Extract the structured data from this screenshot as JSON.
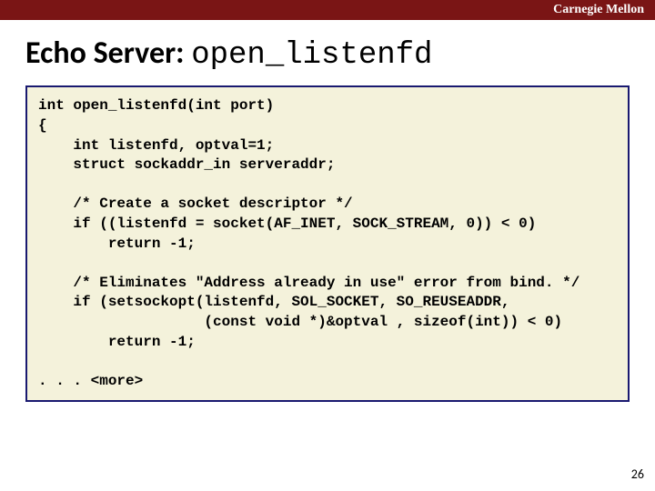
{
  "header": {
    "brand": "Carnegie Mellon"
  },
  "title": {
    "prefix": "Echo Server: ",
    "func": "open_listenfd"
  },
  "code": {
    "l01": "int open_listenfd(int port)",
    "l02": "{",
    "l03": "    int listenfd, optval=1;",
    "l04": "    struct sockaddr_in serveraddr;",
    "l05": "",
    "l06": "    /* Create a socket descriptor */",
    "l07": "    if ((listenfd = socket(AF_INET, SOCK_STREAM, 0)) < 0)",
    "l08": "        return -1;",
    "l09": "",
    "l10": "    /* Eliminates \"Address already in use\" error from bind. */",
    "l11": "    if (setsockopt(listenfd, SOL_SOCKET, SO_REUSEADDR,",
    "l12": "                   (const void *)&optval , sizeof(int)) < 0)",
    "l13": "        return -1;",
    "l14": "",
    "l15": ". . . <more>"
  },
  "page_number": "26"
}
